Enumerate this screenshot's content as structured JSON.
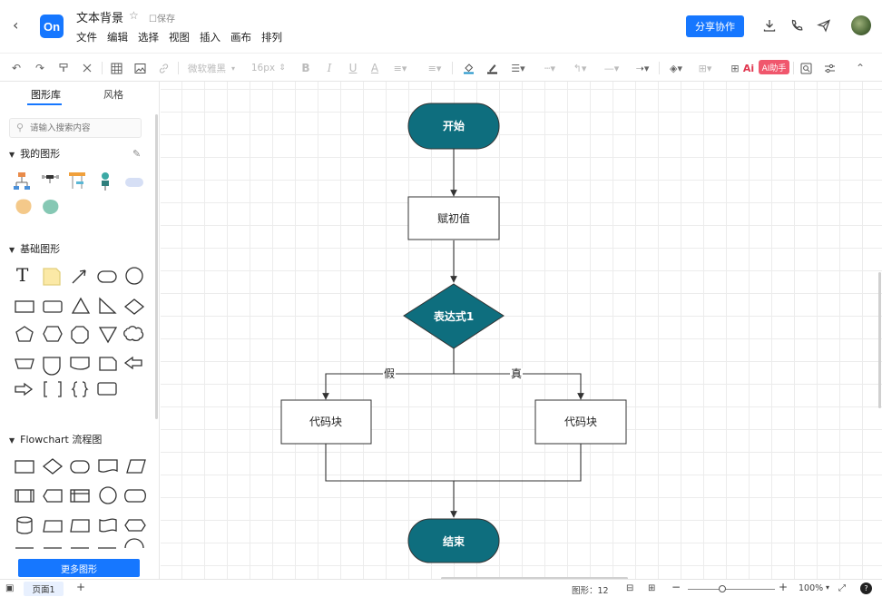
{
  "header": {
    "back": "‹",
    "logo": "On",
    "title": "文本背景",
    "save_status": "☐保存",
    "menu": [
      "文件",
      "编辑",
      "选择",
      "视图",
      "插入",
      "画布",
      "排列"
    ],
    "share": "分享协作"
  },
  "toolbar": {
    "font_family": "微软雅黑",
    "font_size": "16px",
    "ai_label": "Ai",
    "ai_assist": "AI助手"
  },
  "sidebar": {
    "tabs": [
      "图形库",
      "风格"
    ],
    "search_placeholder": "请输入搜索内容",
    "sections": {
      "mine": "我的图形",
      "basic": "基础图形",
      "flowchart": "Flowchart 流程图"
    },
    "more_button": "更多图形"
  },
  "diagram": {
    "start": "开始",
    "init": "赋初值",
    "decision": "表达式1",
    "false_label": "假",
    "true_label": "真",
    "block_left": "代码块",
    "block_right": "代码块",
    "end": "结束",
    "colors": {
      "terminal": "#0e6e7e",
      "border": "#333333"
    }
  },
  "status": {
    "page": "页面1",
    "shapes_label": "图形：12",
    "zoom": "100%"
  }
}
